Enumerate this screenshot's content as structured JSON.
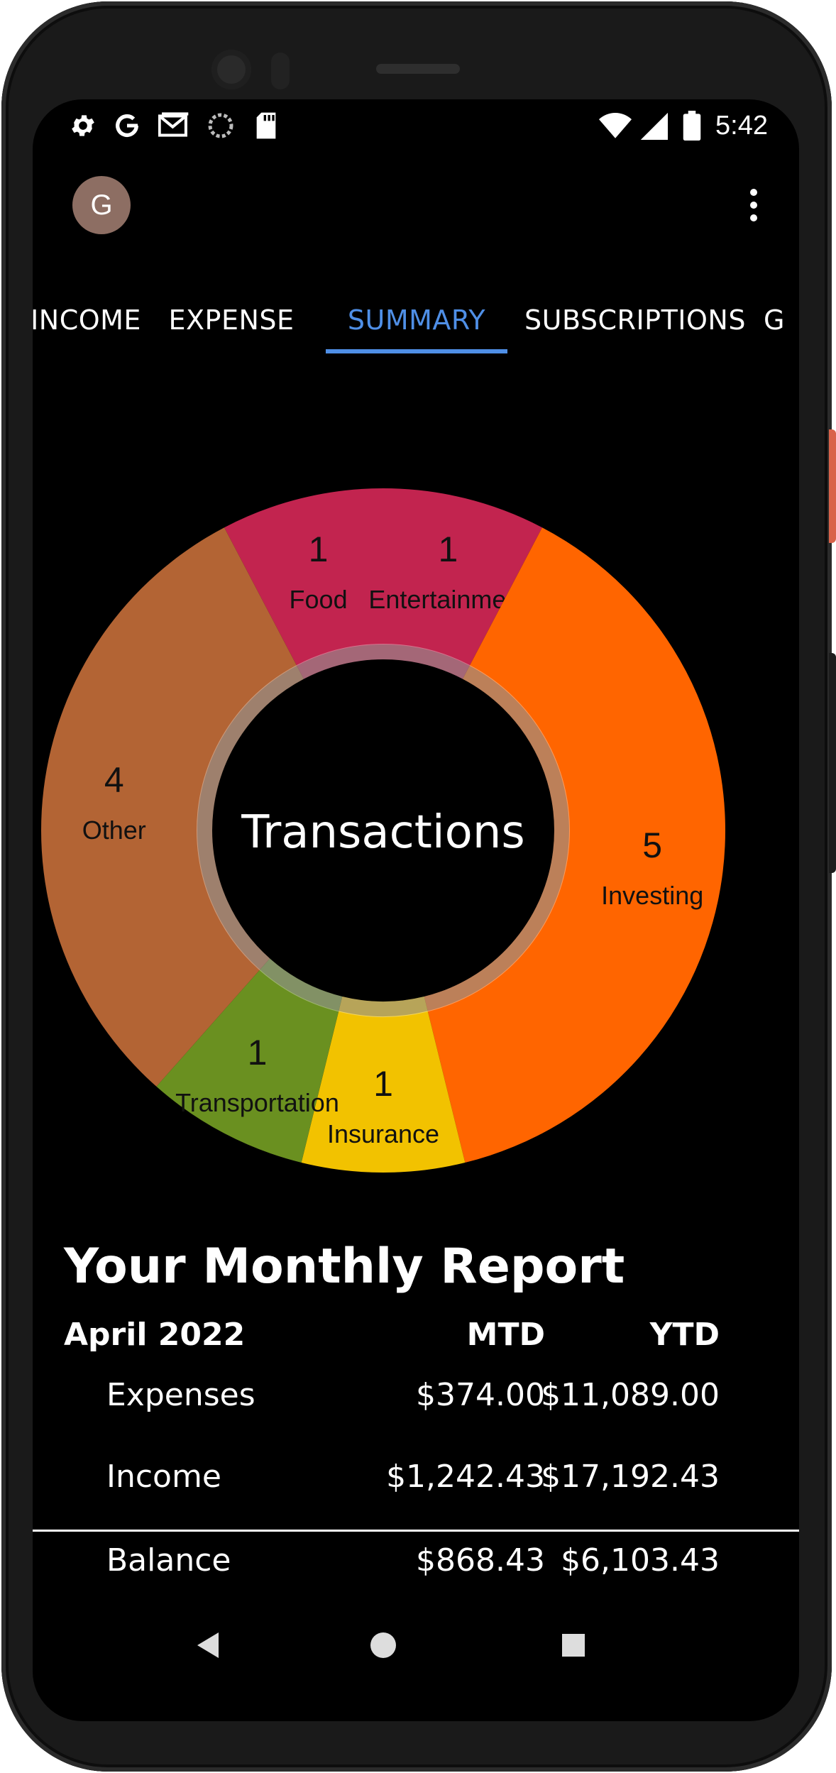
{
  "status_bar": {
    "time": "5:42",
    "left_icons": [
      "gear-icon",
      "google-icon",
      "gmail-icon",
      "loading-icon",
      "sd-card-icon"
    ],
    "right_icons": [
      "wifi-icon",
      "cell-signal-icon",
      "battery-icon"
    ]
  },
  "app_bar": {
    "avatar_letter": "G",
    "avatar_color": "#8d6e63",
    "menu_icon": "more-vert-icon"
  },
  "tabs": [
    {
      "label": "INCOME"
    },
    {
      "label": "EXPENSE"
    },
    {
      "label": "SUMMARY",
      "active": true
    },
    {
      "label": "SUBSCRIPTIONS"
    },
    {
      "label": "G"
    }
  ],
  "accent": "#4f8fe6",
  "chart_data": {
    "type": "pie",
    "title": "Transactions",
    "categories": [
      "Food",
      "Entertainment",
      "Investing",
      "Insurance",
      "Transportation",
      "Other"
    ],
    "values": [
      1,
      1,
      5,
      1,
      1,
      4
    ],
    "colors": [
      "#c2244f",
      "#c2244f",
      "#ff6500",
      "#f2c200",
      "#6a9020",
      "#b36434"
    ]
  },
  "report": {
    "title": "Your Monthly Report",
    "period": "April 2022",
    "mtd_label": "MTD",
    "ytd_label": "YTD",
    "rows": [
      {
        "label": "Expenses",
        "mtd": "$374.00",
        "ytd": "$11,089.00"
      },
      {
        "label": "Income",
        "mtd": "$1,242.43",
        "ytd": "$17,192.43"
      }
    ],
    "balance": {
      "label": "Balance",
      "mtd": "$868.43",
      "ytd": "$6,103.43"
    }
  },
  "nav_bar": {
    "icons": [
      "back-icon",
      "home-icon",
      "recents-icon"
    ]
  }
}
